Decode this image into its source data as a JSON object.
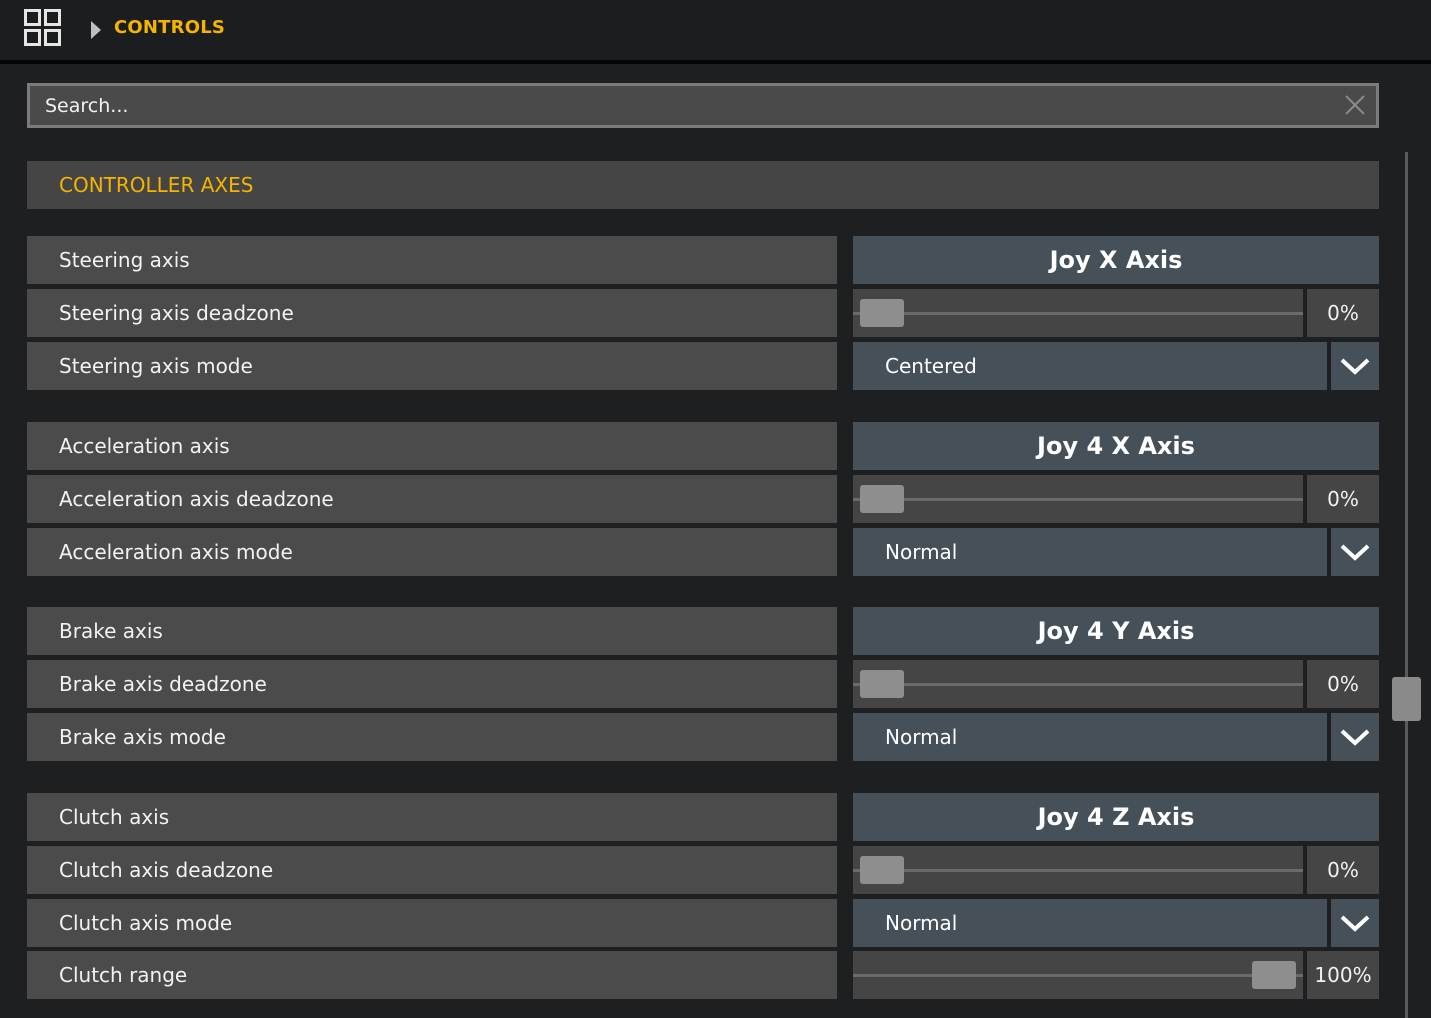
{
  "header": {
    "breadcrumb": "CONTROLS",
    "grid_icon": "grid-icon",
    "arrow_icon": "caret-right-icon"
  },
  "search": {
    "placeholder": "Search...",
    "value": "",
    "clear_icon": "close-icon"
  },
  "section": {
    "title": "CONTROLLER AXES"
  },
  "colors": {
    "accent": "#f5b400",
    "row_bg": "#4b4b4b",
    "button_bg": "#455059",
    "background": "#1e1f21"
  },
  "groups": [
    {
      "axis_label": "Steering axis",
      "axis_value": "Joy X Axis",
      "deadzone_label": "Steering axis deadzone",
      "deadzone_value": "0%",
      "deadzone_fraction": 0,
      "mode_label": "Steering axis mode",
      "mode_value": "Centered"
    },
    {
      "axis_label": "Acceleration axis",
      "axis_value": "Joy 4 X Axis",
      "deadzone_label": "Acceleration axis deadzone",
      "deadzone_value": "0%",
      "deadzone_fraction": 0,
      "mode_label": "Acceleration axis mode",
      "mode_value": "Normal"
    },
    {
      "axis_label": "Brake axis",
      "axis_value": "Joy 4 Y Axis",
      "deadzone_label": "Brake axis deadzone",
      "deadzone_value": "0%",
      "deadzone_fraction": 0,
      "mode_label": "Brake axis mode",
      "mode_value": "Normal"
    },
    {
      "axis_label": "Clutch axis",
      "axis_value": "Joy 4 Z Axis",
      "deadzone_label": "Clutch axis deadzone",
      "deadzone_value": "0%",
      "deadzone_fraction": 0,
      "mode_label": "Clutch axis mode",
      "mode_value": "Normal"
    }
  ],
  "clutch_range": {
    "label": "Clutch range",
    "value": "100%",
    "fraction": 1.0
  }
}
